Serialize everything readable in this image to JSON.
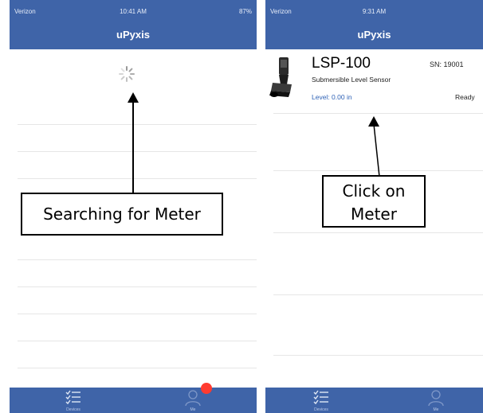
{
  "left_screen": {
    "status": {
      "carrier": "Verizon",
      "time": "10:41 AM",
      "battery": "87%"
    },
    "nav_title": "uPyxis",
    "callout": "Searching for Meter",
    "tabs": [
      {
        "label": "Devices",
        "icon": "checklist-icon"
      },
      {
        "label": "Me",
        "icon": "person-icon",
        "badge": true
      }
    ]
  },
  "right_screen": {
    "status": {
      "carrier": "Verizon",
      "time": "9:31 AM"
    },
    "nav_title": "uPyxis",
    "device": {
      "model": "LSP-100",
      "serial": "SN: 19001",
      "type": "Submersible Level Sensor",
      "level": "Level: 0.00 in",
      "status": "Ready"
    },
    "callout_line1": "Click on",
    "callout_line2": "Meter",
    "tabs": [
      {
        "label": "Devices",
        "icon": "checklist-icon"
      },
      {
        "label": "Me",
        "icon": "person-icon"
      }
    ]
  },
  "colors": {
    "nav_blue": "#3f64a8",
    "link_blue": "#2f62b6",
    "badge_red": "#ff3b30"
  }
}
